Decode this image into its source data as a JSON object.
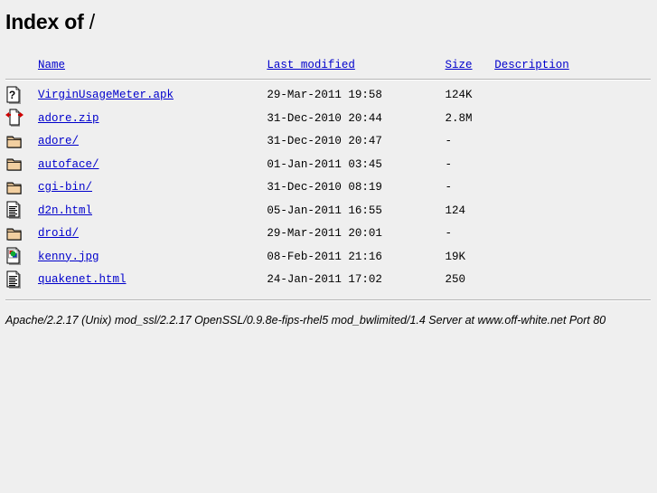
{
  "page": {
    "title_prefix": "Index of",
    "title_path": "/",
    "background_color": "#efefef",
    "link_color": "#0000cc"
  },
  "columns": {
    "name": "Name",
    "last_modified": "Last modified",
    "size": "Size",
    "description": "Description"
  },
  "entries": [
    {
      "icon": "unknown-file-icon",
      "name": "VirginUsageMeter.apk",
      "last_modified": "29-Mar-2011 19:58",
      "size": "124K",
      "description": ""
    },
    {
      "icon": "compressed-file-icon",
      "name": "adore.zip",
      "last_modified": "31-Dec-2010 20:44",
      "size": "2.8M",
      "description": ""
    },
    {
      "icon": "folder-icon",
      "name": "adore/",
      "last_modified": "31-Dec-2010 20:47",
      "size": "-",
      "description": ""
    },
    {
      "icon": "folder-icon",
      "name": "autoface/",
      "last_modified": "01-Jan-2011 03:45",
      "size": "-",
      "description": ""
    },
    {
      "icon": "folder-icon",
      "name": "cgi-bin/",
      "last_modified": "31-Dec-2010 08:19",
      "size": "-",
      "description": ""
    },
    {
      "icon": "text-document-icon",
      "name": "d2n.html",
      "last_modified": "05-Jan-2011 16:55",
      "size": "124",
      "description": ""
    },
    {
      "icon": "folder-icon",
      "name": "droid/",
      "last_modified": "29-Mar-2011 20:01",
      "size": "-",
      "description": ""
    },
    {
      "icon": "image-file-icon",
      "name": "kenny.jpg",
      "last_modified": "08-Feb-2011 21:16",
      "size": "19K",
      "description": ""
    },
    {
      "icon": "text-document-icon",
      "name": "quakenet.html",
      "last_modified": "24-Jan-2011 17:02",
      "size": "250",
      "description": ""
    }
  ],
  "footer": {
    "text": "Apache/2.2.17 (Unix) mod_ssl/2.2.17 OpenSSL/0.9.8e-fips-rhel5 mod_bwlimited/1.4 Server at www.off-white.net Port 80"
  }
}
